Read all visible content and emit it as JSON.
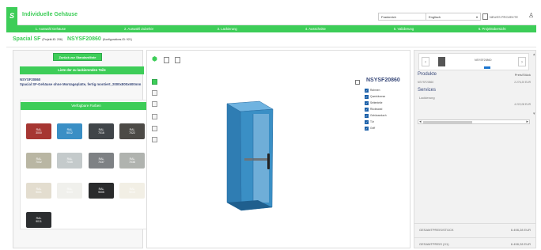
{
  "header": {
    "app_title": "Individuelle Gehäuse",
    "country_select": "Frankreich",
    "language_select": "Englisch",
    "new_project_label": "NEUES PROJEKTE",
    "logo_letter": "S"
  },
  "steps": [
    "1. Auswahl Gehäuse",
    "2. Auswahl Zubehör",
    "3. Lackierung",
    "4. Ausschnitte",
    "5. Validierung",
    "6. Projektübersicht"
  ],
  "subheader": {
    "title": "Spacial SF",
    "project_id": "(Projekt-ID: 206)",
    "reference": "NSYSF20860",
    "config_id": "(Konfigurations-ID: 921)"
  },
  "left_panel": {
    "back_button": "Zurück zur Standardliste",
    "list_header": "Liste der zu lackierenden Teile",
    "part_code": "NSYSF20860",
    "part_desc": "Spacial SF-Gehäuse ohne Montageplatte, fertig montiert, 2000x800x600mm",
    "colors_header": "Verfügbare Farben",
    "colors": [
      {
        "code": "RAL 3000",
        "hex": "#a63632",
        "text": "#ffffff"
      },
      {
        "code": "RAL 5012",
        "hex": "#3a8fc5",
        "text": "#ffffff"
      },
      {
        "code": "RAL 7016",
        "hex": "#404549",
        "text": "#ffffff"
      },
      {
        "code": "RAL 7022",
        "hex": "#4c4a46",
        "text": "#ffffff"
      },
      {
        "code": "RAL 7032",
        "hex": "#b9b6a3",
        "text": "#ffffff"
      },
      {
        "code": "RAL 7035",
        "hex": "#c4cacb",
        "text": "#ffffff"
      },
      {
        "code": "RAL 7037",
        "hex": "#7e8184",
        "text": "#ffffff"
      },
      {
        "code": "RAL 7038",
        "hex": "#b0b3af",
        "text": "#ffffff"
      },
      {
        "code": "RAL 9001",
        "hex": "#e3ddcf",
        "text": "#ffffff"
      },
      {
        "code": "RAL 9003",
        "hex": "#f0f0ec",
        "text": "#ffffff"
      },
      {
        "code": "RAL 9005",
        "hex": "#2a2b2c",
        "text": "#ffffff"
      },
      {
        "code": "RAL 9010",
        "hex": "#f2efe5",
        "text": "#ffffff"
      },
      {
        "code": "RAL 9011",
        "hex": "#2c2e30",
        "text": "#ffffff"
      }
    ]
  },
  "viewer": {
    "product_id": "NSYSF20860",
    "parts": [
      "Rahmen",
      "Querträverse",
      "Seitenteile",
      "Rückwand",
      "Gehäusedach",
      "Tür",
      "Griff"
    ],
    "accent": "#3dcd58",
    "enclosure_color": "#3a8fc5"
  },
  "right_panel": {
    "carousel_label": "NSYSF20860",
    "produkte_title": "Produkte",
    "price_header": "Preis/Stück",
    "product_line_code": "NSYSF20860",
    "product_line_price": "2.276,20 EUR",
    "services_title": "Services",
    "services_item": "Lackierung",
    "services_price": "4.222,08 EUR",
    "total_piece_label": "GESAMTPREIS/STÜCK",
    "total_piece_value": "6.498,28 EUR",
    "total_label": "GESAMTPREIS (X1)",
    "total_value": "6.498,28 EUR"
  }
}
